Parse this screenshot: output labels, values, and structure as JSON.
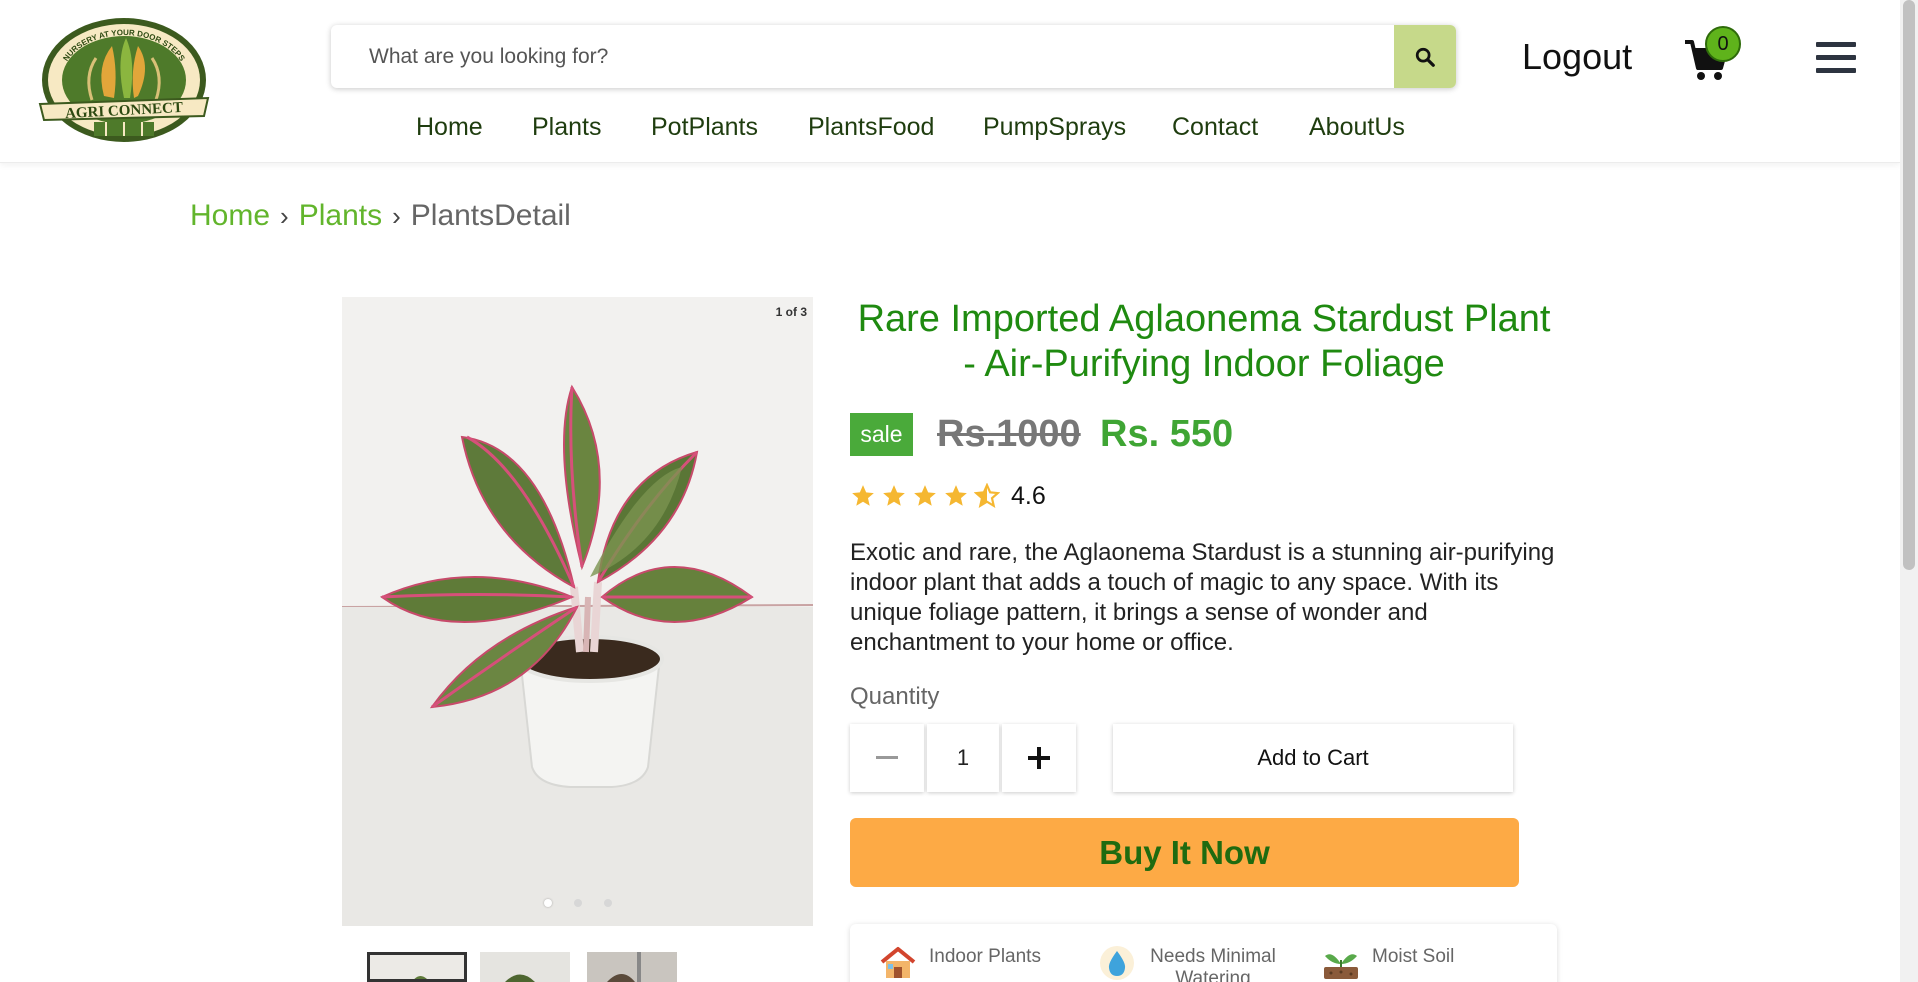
{
  "header": {
    "logo_top_text": "NURSERY AT YOUR DOOR STEPS",
    "logo_brand": "AGRI CONNECT",
    "search_placeholder": "What are you looking for?",
    "logout_label": "Logout",
    "cart_count": "0"
  },
  "nav": {
    "items": [
      {
        "label": "Home"
      },
      {
        "label": "Plants"
      },
      {
        "label": "PotPlants"
      },
      {
        "label": "PlantsFood"
      },
      {
        "label": "PumpSprays"
      },
      {
        "label": "Contact"
      },
      {
        "label": "AboutUs"
      }
    ]
  },
  "breadcrumb": {
    "home": "Home",
    "plants": "Plants",
    "current": "PlantsDetail",
    "separator": "›"
  },
  "gallery": {
    "counter": "1 of 3",
    "dots": 3,
    "active_index": 0
  },
  "product": {
    "title": "Rare Imported Aglaonema Stardust Plant - Air-Purifying Indoor Foliage",
    "sale_badge": "sale",
    "old_price": "Rs.1000",
    "new_price": "Rs. 550",
    "rating": "4.6",
    "description": "Exotic and rare, the Aglaonema Stardust is a stunning air-purifying indoor plant that adds a touch of magic to any space. With its unique foliage pattern, it brings a sense of wonder and enchantment to your home or office.",
    "quantity_label": "Quantity",
    "quantity_value": "1",
    "add_to_cart_label": "Add to Cart",
    "buy_now_label": "Buy It Now"
  },
  "features": [
    {
      "icon": "house-icon",
      "label": "Indoor Plants"
    },
    {
      "icon": "water-drop-icon",
      "label": "Needs Minimal Watering"
    },
    {
      "icon": "sprout-soil-icon",
      "label": "Moist Soil"
    }
  ],
  "colors": {
    "brand_green": "#1f8a10",
    "link_green": "#62b52c",
    "price_green": "#3fa534",
    "sale_badge": "#4aaa3a",
    "search_button": "#c6d98a",
    "buy_now": "#fdaa45",
    "cart_badge": "#5fb31b"
  }
}
